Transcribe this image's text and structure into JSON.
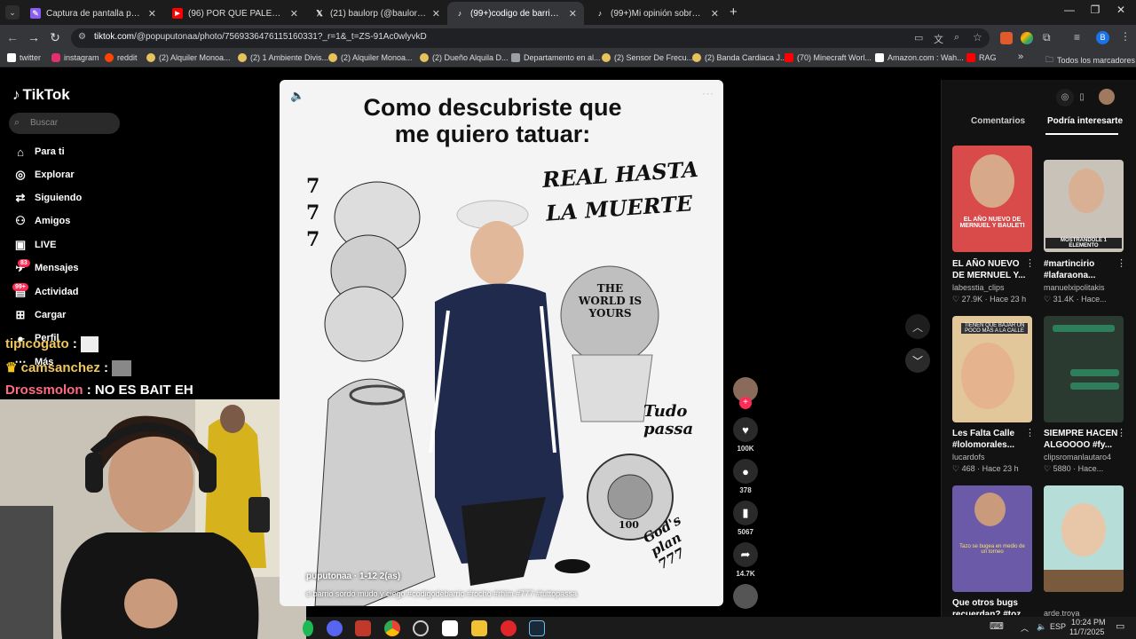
{
  "browser": {
    "tabs": [
      {
        "title": "Captura de pantalla por Lightsh",
        "icon": "lightshot-icon",
        "color": "#8a5cf6"
      },
      {
        "title": "(96) POR QUÉ PALERMO ES TAN",
        "icon": "youtube-icon",
        "color": "#ff0000"
      },
      {
        "title": "(21) baulorp (@baulorp) / X",
        "icon": "x-icon",
        "color": "#ffffff"
      },
      {
        "title": "(99+)codigo de barrio sordo m",
        "icon": "tiktok-icon",
        "color": "#ffffff"
      },
      {
        "title": "(99+)Mi opinión sobre Camnai",
        "icon": "tiktok-icon",
        "color": "#ffffff"
      }
    ],
    "new_tab": "+",
    "url_host": "tiktok.com",
    "url_path": "/@popuputonaa/photo/7569336476115160331?_r=1&_t=ZS-91Ac0wlyvkD",
    "bookmarks": [
      {
        "label": "twitter",
        "color": "#ffffff"
      },
      {
        "label": "instagram",
        "color": "#e1306c"
      },
      {
        "label": "reddit",
        "color": "#ff4500"
      },
      {
        "label": "(2) Alquiler Monoa...",
        "color": "#e6c35c"
      },
      {
        "label": "(2) 1 Ambiente Divis...",
        "color": "#e6c35c"
      },
      {
        "label": "(2) Alquiler Monoa...",
        "color": "#e6c35c"
      },
      {
        "label": "(2) Dueño Alquila D...",
        "color": "#e6c35c"
      },
      {
        "label": "Departamento en al...",
        "color": "#9aa0a6"
      },
      {
        "label": "(2) Sensor De Frecu...",
        "color": "#e6c35c"
      },
      {
        "label": "(2) Banda Cardiaca J...",
        "color": "#e6c35c"
      },
      {
        "label": "(70) Minecraft Worl...",
        "color": "#ff0000"
      },
      {
        "label": "Amazon.com : Wah...",
        "color": "#ffffff"
      },
      {
        "label": "RAG",
        "color": "#ff0000"
      }
    ],
    "bookmarks_more": "»",
    "all_bookmarks": "Todos los marcadores"
  },
  "tiktok": {
    "logo": "TikTok",
    "search_placeholder": "Buscar",
    "nav": [
      {
        "label": "Para ti",
        "icon": "home-icon",
        "glyph": "⌂"
      },
      {
        "label": "Explorar",
        "icon": "compass-icon",
        "glyph": "◎"
      },
      {
        "label": "Siguiendo",
        "icon": "following-icon",
        "glyph": "⇄"
      },
      {
        "label": "Amigos",
        "icon": "friends-icon",
        "glyph": "⚇"
      },
      {
        "label": "LIVE",
        "icon": "live-icon",
        "glyph": "▣"
      },
      {
        "label": "Mensajes",
        "icon": "messages-icon",
        "glyph": "✈"
      },
      {
        "label": "Actividad",
        "icon": "activity-icon",
        "glyph": "▤"
      },
      {
        "label": "Cargar",
        "icon": "upload-icon",
        "glyph": "⊞"
      },
      {
        "label": "Perfil",
        "icon": "profile-icon",
        "glyph": "●"
      },
      {
        "label": "Más",
        "icon": "more-icon",
        "glyph": "⋯"
      }
    ],
    "messages_badge": "83",
    "activity_badge": "99+",
    "post": {
      "headline_line1": "Como descubriste que",
      "headline_line2": "me quiero tatuar:",
      "tattoo_real": "REAL HASTA",
      "tattoo_muerte": "LA MUERTE",
      "tattoo_sevens": "7\n7\n7",
      "tattoo_world": "THE WORLD IS YOURS",
      "tattoo_tudo": "Tudo passa",
      "tattoo_gods": "God's plan 777",
      "money_note": "100",
      "caption": "e barrio sordo mudo y ciego #codigodebarrio #rocho #rhlm #777 #tuttopassa",
      "author_partial": "puputonaa · 1-12 2(as)"
    },
    "actions": {
      "likes": "100K",
      "comments": "378",
      "saves": "5067",
      "shares": "14.7K"
    },
    "right_tabs": {
      "comments": "Comentarios",
      "interest": "Podría interesarte"
    },
    "recommendations": [
      {
        "title": "EL AÑO NUEVO DE MERNUEL Y...",
        "user": "labesstia_clips",
        "views": "27.9K",
        "time": "Hace 23 h",
        "overlay": "EL AÑO NUEVO DE MERNUEL Y BAULETI",
        "bg": "#d94a4a"
      },
      {
        "title": "#martincirio #lafaraona...",
        "user": "manuelxipolitakis",
        "views": "31.4K",
        "time": "Hace...",
        "overlay": "MOSTRANDOLE 1 ELEMENTO",
        "bg": "#c9c2b8"
      },
      {
        "title": "Les Falta Calle #lolomorales...",
        "user": "lucardofs",
        "views": "468",
        "time": "Hace 23 h",
        "overlay": "TIENEN QUE BAJAR UN POCO MÁS A LA CALLE",
        "bg": "#e2c79a"
      },
      {
        "title": "SIEMPRE HACEN ALGOOOO #fy...",
        "user": "clipsromanlautaro4",
        "views": "5880",
        "time": "Hace...",
        "overlay": "",
        "bg": "#2b3a30"
      },
      {
        "title": "Que otros bugs recuerdan? #toz...",
        "user": "",
        "views": "",
        "time": "",
        "overlay": "Tazo se bugea en medio de un torneo",
        "bg": "#6b5aa8"
      },
      {
        "title": "",
        "user": "arde.troya",
        "views": "",
        "time": "",
        "overlay": "",
        "bg": "#b7ddd9"
      }
    ]
  },
  "chat": [
    {
      "user": "tipicogato",
      "sep": ":",
      "text": ""
    },
    {
      "user": "camsanchez",
      "sep": ":",
      "text": ""
    },
    {
      "user": "Drossmolon",
      "sep": ":",
      "text": "NO ES BAIT EH"
    }
  ],
  "taskbar": {
    "lang": "ESP",
    "time": "10:24 PM",
    "date": "11/7/2025"
  }
}
